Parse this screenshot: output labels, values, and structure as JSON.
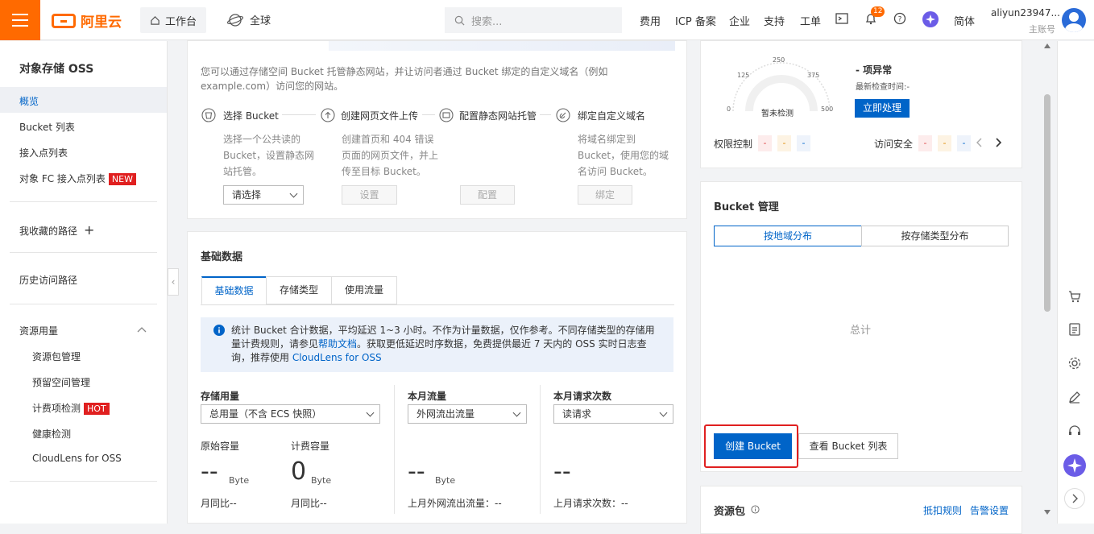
{
  "header": {
    "brand": "阿里云",
    "workbench": "工作台",
    "region": "全球",
    "search_placeholder": "搜索...",
    "nav": [
      "费用",
      "ICP 备案",
      "企业",
      "支持",
      "工单"
    ],
    "notif_count": "12",
    "lang": "简体",
    "username": "aliyun23947...",
    "account_type": "主账号"
  },
  "sidebar": {
    "title": "对象存储 OSS",
    "items": [
      "概览",
      "Bucket 列表",
      "接入点列表",
      "对象 FC 接入点列表"
    ],
    "new_tag": "NEW",
    "favorites": "我收藏的路径",
    "history": "历史访问路径",
    "resource_group": "资源用量",
    "sub_items": [
      "资源包管理",
      "预留空间管理",
      "计费项检测",
      "健康检测",
      "CloudLens for OSS"
    ],
    "hot_tag": "HOT"
  },
  "website": {
    "intro": "您可以通过存储空间 Bucket 托管静态网站，并让访问者通过 Bucket 绑定的自定义域名（例如example.com）访问您的网站。",
    "steps": [
      {
        "title": "选择 Bucket",
        "desc": "选择一个公共读的 Bucket，设置静态网站托管。",
        "action": "请选择"
      },
      {
        "title": "创建网页文件上传",
        "desc": "创建首页和 404 错误页面的网页文件，并上传至目标 Bucket。",
        "action": "设置"
      },
      {
        "title": "配置静态网站托管",
        "desc": "",
        "action": "配置"
      },
      {
        "title": "绑定自定义域名",
        "desc": "将域名绑定到 Bucket，使用您的域名访问 Bucket。",
        "action": "绑定"
      }
    ]
  },
  "basic": {
    "title": "基础数据",
    "tabs": [
      "基础数据",
      "存储类型",
      "使用流量"
    ],
    "notice_pre": "统计 Bucket 合计数据，平均延迟 1~3 小时。不作为计量数据，仅作参考。不同存储类型的存储用量计费规则，请参见",
    "notice_link": "帮助文档",
    "notice_mid": "。获取更低延迟时序数据，免费提供最近 7 天内的 OSS 实时日志查询，推荐使用",
    "notice_link2": "CloudLens for OSS",
    "storage_title": "存储用量",
    "storage_select": "总用量（不含 ECS 快照）",
    "orig_label": "原始容量",
    "orig_value": "--",
    "unit": "Byte",
    "bill_label": "计费容量",
    "bill_value": "0",
    "mom1": "月同比--",
    "mom2": "月同比--",
    "traffic_title": "本月流量",
    "traffic_select": "外网流出流量",
    "traffic_value": "--",
    "traffic_last": "上月外网流出流量：--",
    "req_title": "本月请求次数",
    "req_select": "读请求",
    "req_value": "--",
    "req_last": "上月请求次数：--"
  },
  "security": {
    "gauge_ticks": [
      "0",
      "125",
      "250",
      "375",
      "500"
    ],
    "gauge_label": "暂未检测",
    "abnormal": "- 项异常",
    "last_check": "最新检查时间:-",
    "handle_btn": "立即处理",
    "perm_label": "权限控制",
    "access_label": "访问安全",
    "dash": "-"
  },
  "bucket_mgmt": {
    "title": "Bucket 管理",
    "tabs": [
      "按地域分布",
      "按存储类型分布"
    ],
    "total": "总计",
    "create_btn": "创建 Bucket",
    "list_btn": "查看 Bucket 列表"
  },
  "package": {
    "title": "资源包",
    "rule": "抵扣规则",
    "alert": "告警设置"
  },
  "colors": {
    "brand": "#ff6a00",
    "primary": "#0064c8",
    "highlight": "#e02020"
  }
}
